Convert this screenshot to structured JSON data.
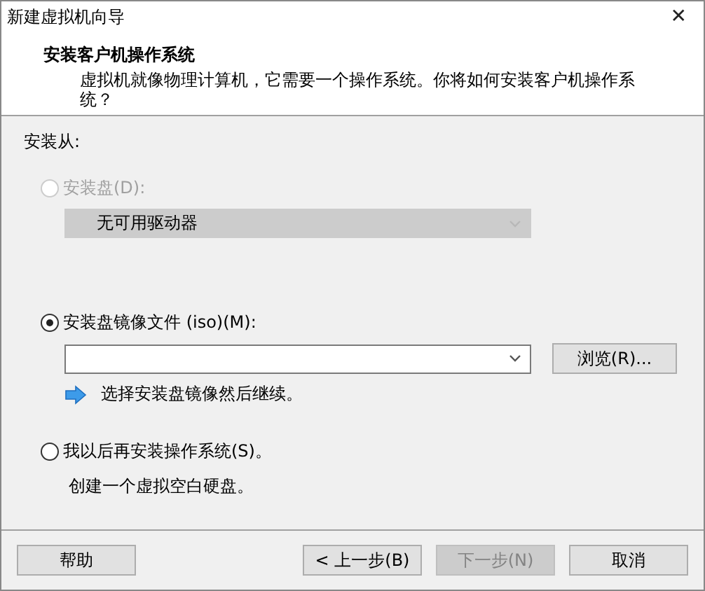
{
  "window": {
    "title": "新建虚拟机向导",
    "close": "✕"
  },
  "header": {
    "title": "安装客户机操作系统",
    "description": "虚拟机就像物理计算机，它需要一个操作系统。你将如何安装客户机操作系统？"
  },
  "install_from": {
    "label": "安装从:"
  },
  "options": [
    {
      "kind": "drive",
      "label": "安装盘(D):",
      "selected": false,
      "disabled": true,
      "dropdown": {
        "value": "无可用驱动器",
        "disabled": true
      }
    },
    {
      "kind": "iso",
      "label": "安装盘镜像文件 (iso)(M):",
      "selected": true,
      "disabled": false,
      "dropdown": {
        "disabled": false
      },
      "browse": "浏览(R)...",
      "hint": "选择安装盘镜像然后继续。"
    },
    {
      "kind": "later",
      "label": "我以后再安装操作系统(S)。",
      "selected": false,
      "disabled": false,
      "note": "创建一个虚拟空白硬盘。"
    }
  ],
  "buttons": [
    {
      "kind": "help",
      "label": "帮助",
      "disabled": false
    },
    {
      "kind": "back",
      "label": "< 上一步(B)",
      "disabled": false
    },
    {
      "kind": "next",
      "label": "下一步(N)",
      "disabled": true
    },
    {
      "kind": "cancel",
      "label": "取消",
      "disabled": false
    }
  ]
}
